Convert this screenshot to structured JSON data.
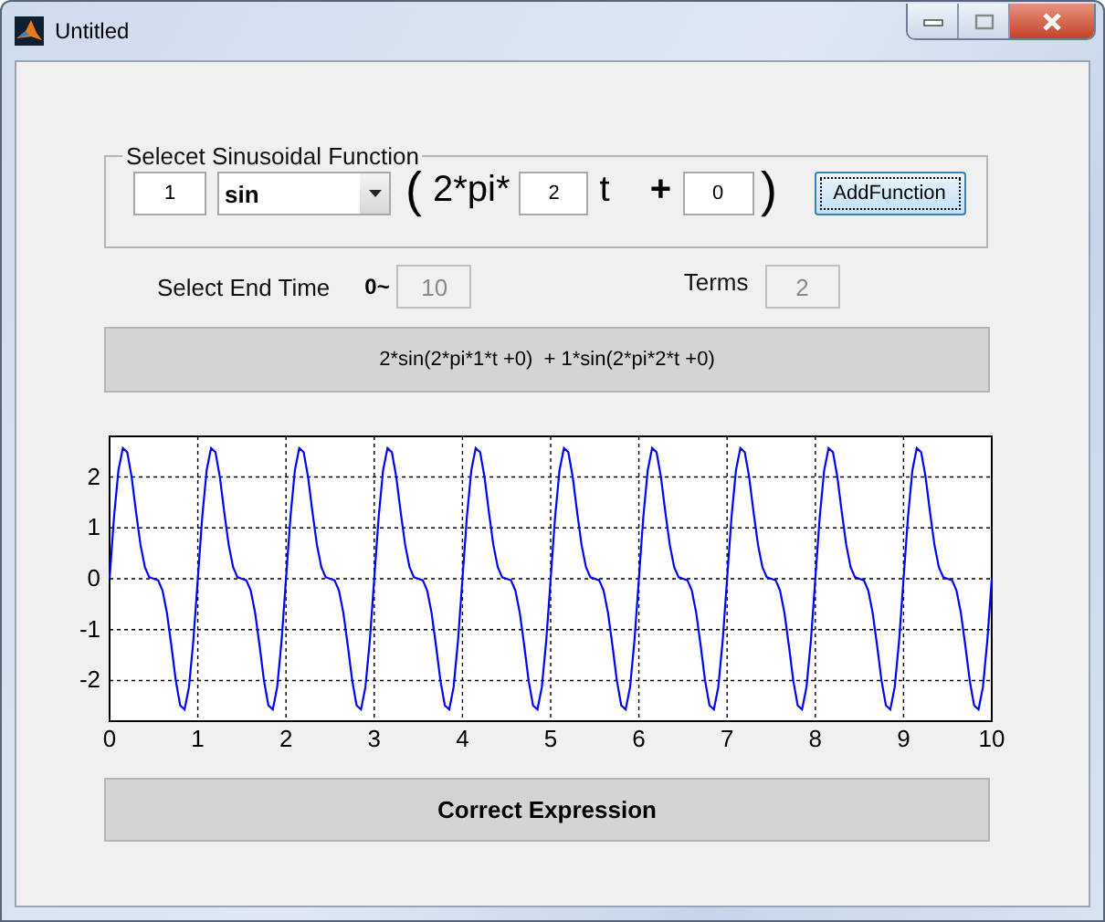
{
  "window": {
    "title": "Untitled"
  },
  "function_panel": {
    "title": "Selecet Sinusoidal Function",
    "amplitude": "1",
    "function": "sin",
    "open_paren": "(",
    "prefix": "2*pi*",
    "frequency": "2",
    "variable": "t",
    "plus": "+",
    "phase": "0",
    "close_paren": ")",
    "button": {
      "label": "AddFunction",
      "focused": true
    }
  },
  "end_time": {
    "label": "Select End Time",
    "prefix": "0~",
    "value": "10",
    "disabled": true
  },
  "terms": {
    "label": "Terms",
    "value": "2",
    "disabled": true
  },
  "expression": "2*sin(2*pi*1*t +0)  + 1*sin(2*pi*2*t +0)",
  "chart_data": {
    "type": "line",
    "grid": true,
    "xlim": [
      0,
      10
    ],
    "ylim": [
      -2.8,
      2.8
    ],
    "xticks": [
      0,
      1,
      2,
      3,
      4,
      5,
      6,
      7,
      8,
      9,
      10
    ],
    "yticks": [
      -2,
      -1,
      0,
      1,
      2
    ],
    "x": [
      0,
      0.05,
      0.1,
      0.15,
      0.2,
      0.25,
      0.3,
      0.35,
      0.4,
      0.45,
      0.5,
      0.55,
      0.6,
      0.65,
      0.7,
      0.75,
      0.8,
      0.85,
      0.9,
      0.95,
      1,
      1.05,
      1.1,
      1.15,
      1.2,
      1.25,
      1.3,
      1.35,
      1.4,
      1.45,
      1.5,
      1.55,
      1.6,
      1.65,
      1.7,
      1.75,
      1.8,
      1.85,
      1.9,
      1.95,
      2,
      2.05,
      2.1,
      2.15,
      2.2,
      2.25,
      2.3,
      2.35,
      2.4,
      2.45,
      2.5,
      2.55,
      2.6,
      2.65,
      2.7,
      2.75,
      2.8,
      2.85,
      2.9,
      2.95,
      3,
      3.05,
      3.1,
      3.15,
      3.2,
      3.25,
      3.3,
      3.35,
      3.4,
      3.45,
      3.5,
      3.55,
      3.6,
      3.65,
      3.7,
      3.75,
      3.8,
      3.85,
      3.9,
      3.95,
      4,
      4.05,
      4.1,
      4.15,
      4.2,
      4.25,
      4.3,
      4.35,
      4.4,
      4.45,
      4.5,
      4.55,
      4.6,
      4.65,
      4.7,
      4.75,
      4.8,
      4.85,
      4.9,
      4.95,
      5,
      5.05,
      5.1,
      5.15,
      5.2,
      5.25,
      5.3,
      5.35,
      5.4,
      5.45,
      5.5,
      5.55,
      5.6,
      5.65,
      5.7,
      5.75,
      5.8,
      5.85,
      5.9,
      5.95,
      6,
      6.05,
      6.1,
      6.15,
      6.2,
      6.25,
      6.3,
      6.35,
      6.4,
      6.45,
      6.5,
      6.55,
      6.6,
      6.65,
      6.7,
      6.75,
      6.8,
      6.85,
      6.9,
      6.95,
      7,
      7.05,
      7.1,
      7.15,
      7.2,
      7.25,
      7.3,
      7.35,
      7.4,
      7.45,
      7.5,
      7.55,
      7.6,
      7.65,
      7.7,
      7.75,
      7.8,
      7.85,
      7.9,
      7.95,
      8,
      8.05,
      8.1,
      8.15,
      8.2,
      8.25,
      8.3,
      8.35,
      8.4,
      8.45,
      8.5,
      8.55,
      8.6,
      8.65,
      8.7,
      8.75,
      8.8,
      8.85,
      8.9,
      8.95,
      9,
      9.05,
      9.1,
      9.15,
      9.2,
      9.25,
      9.3,
      9.35,
      9.4,
      9.45,
      9.5,
      9.55,
      9.6,
      9.65,
      9.7,
      9.75,
      9.8,
      9.85,
      9.9,
      9.95,
      10
    ],
    "series": [
      {
        "color": "#0000ff",
        "values": [
          0,
          1.21,
          2.13,
          2.57,
          2.49,
          2,
          1.31,
          0.67,
          0.23,
          0.03,
          0,
          -0.03,
          -0.23,
          -0.67,
          -1.31,
          -2,
          -2.49,
          -2.57,
          -2.13,
          -1.21,
          0,
          1.21,
          2.13,
          2.57,
          2.49,
          2,
          1.31,
          0.67,
          0.23,
          0.03,
          0,
          -0.03,
          -0.23,
          -0.67,
          -1.31,
          -2,
          -2.49,
          -2.57,
          -2.13,
          -1.21,
          0,
          1.21,
          2.13,
          2.57,
          2.49,
          2,
          1.31,
          0.67,
          0.23,
          0.03,
          0,
          -0.03,
          -0.23,
          -0.67,
          -1.31,
          -2,
          -2.49,
          -2.57,
          -2.13,
          -1.21,
          0,
          1.21,
          2.13,
          2.57,
          2.49,
          2,
          1.31,
          0.67,
          0.23,
          0.03,
          0,
          -0.03,
          -0.23,
          -0.67,
          -1.31,
          -2,
          -2.49,
          -2.57,
          -2.13,
          -1.21,
          0,
          1.21,
          2.13,
          2.57,
          2.49,
          2,
          1.31,
          0.67,
          0.23,
          0.03,
          0,
          -0.03,
          -0.23,
          -0.67,
          -1.31,
          -2,
          -2.49,
          -2.57,
          -2.13,
          -1.21,
          0,
          1.21,
          2.13,
          2.57,
          2.49,
          2,
          1.31,
          0.67,
          0.23,
          0.03,
          0,
          -0.03,
          -0.23,
          -0.67,
          -1.31,
          -2,
          -2.49,
          -2.57,
          -2.13,
          -1.21,
          0,
          1.21,
          2.13,
          2.57,
          2.49,
          2,
          1.31,
          0.67,
          0.23,
          0.03,
          0,
          -0.03,
          -0.23,
          -0.67,
          -1.31,
          -2,
          -2.49,
          -2.57,
          -2.13,
          -1.21,
          0,
          1.21,
          2.13,
          2.57,
          2.49,
          2,
          1.31,
          0.67,
          0.23,
          0.03,
          0,
          -0.03,
          -0.23,
          -0.67,
          -1.31,
          -2,
          -2.49,
          -2.57,
          -2.13,
          -1.21,
          0,
          1.21,
          2.13,
          2.57,
          2.49,
          2,
          1.31,
          0.67,
          0.23,
          0.03,
          0,
          -0.03,
          -0.23,
          -0.67,
          -1.31,
          -2,
          -2.49,
          -2.57,
          -2.13,
          -1.21,
          0,
          1.21,
          2.13,
          2.57,
          2.49,
          2,
          1.31,
          0.67,
          0.23,
          0.03,
          0,
          -0.03,
          -0.23,
          -0.67,
          -1.31,
          -2,
          -2.49,
          -2.57,
          -2.13,
          -1.21,
          0
        ]
      }
    ]
  },
  "status": "Correct Expression"
}
